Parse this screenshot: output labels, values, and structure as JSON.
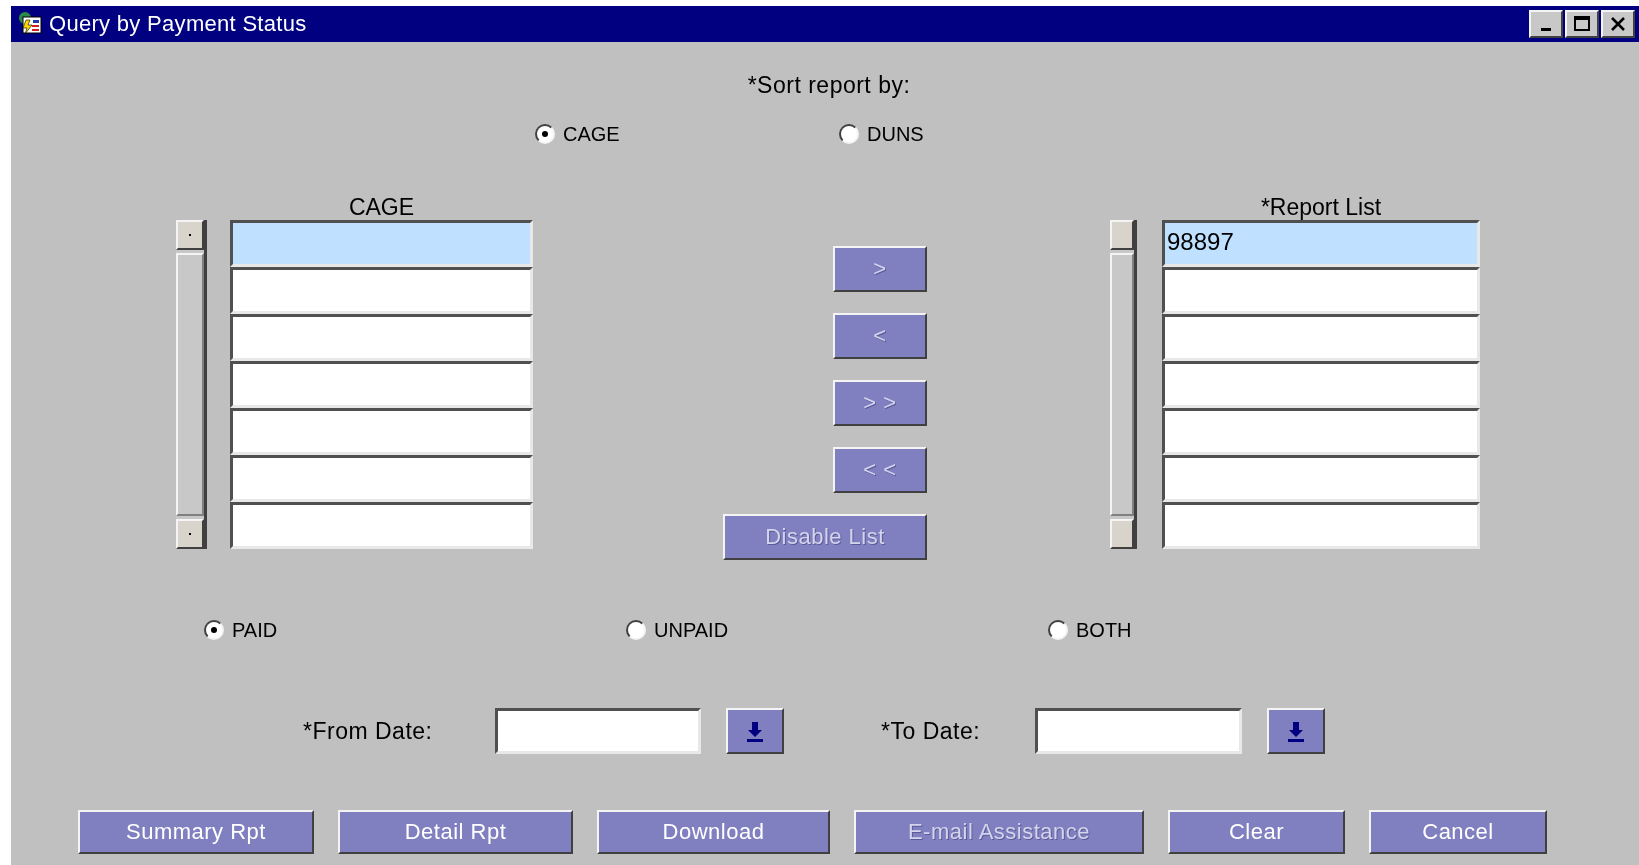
{
  "window": {
    "title": "Query by Payment Status"
  },
  "sort": {
    "label": "*Sort report by:",
    "options": [
      {
        "label": "CAGE",
        "selected": true
      },
      {
        "label": "DUNS",
        "selected": false
      }
    ]
  },
  "lists": [
    {
      "title": "CAGE",
      "rows": [
        {
          "selected": true
        },
        {
          "selected": false
        },
        {
          "selected": false
        },
        {
          "selected": false
        },
        {
          "selected": false
        },
        {
          "selected": false
        },
        {
          "selected": false
        }
      ]
    },
    {
      "title": "*Report List",
      "rows": [
        {
          "value": "98897",
          "selected": true
        },
        {
          "selected": false
        },
        {
          "selected": false
        },
        {
          "selected": false
        },
        {
          "selected": false
        },
        {
          "selected": false
        },
        {
          "selected": false
        }
      ]
    }
  ],
  "transfer_buttons": [
    {
      "label": ">",
      "disabled": true
    },
    {
      "label": "<",
      "disabled": true
    },
    {
      "label": "> >",
      "disabled": true
    },
    {
      "label": "< <",
      "disabled": true
    },
    {
      "label": "Disable List",
      "disabled": true
    }
  ],
  "status": {
    "options": [
      {
        "label": "PAID",
        "selected": true
      },
      {
        "label": "UNPAID",
        "selected": false
      },
      {
        "label": "BOTH",
        "selected": false
      }
    ]
  },
  "dates": [
    {
      "label": "*From Date:"
    },
    {
      "label": "*To Date:"
    }
  ],
  "buttons": [
    {
      "label": "Summary Rpt",
      "disabled": false
    },
    {
      "label": "Detail Rpt",
      "disabled": false
    },
    {
      "label": "Download",
      "disabled": false
    },
    {
      "label": "E-mail Assistance",
      "disabled": true
    },
    {
      "label": "Clear",
      "disabled": false
    },
    {
      "label": "Cancel",
      "disabled": false
    }
  ]
}
